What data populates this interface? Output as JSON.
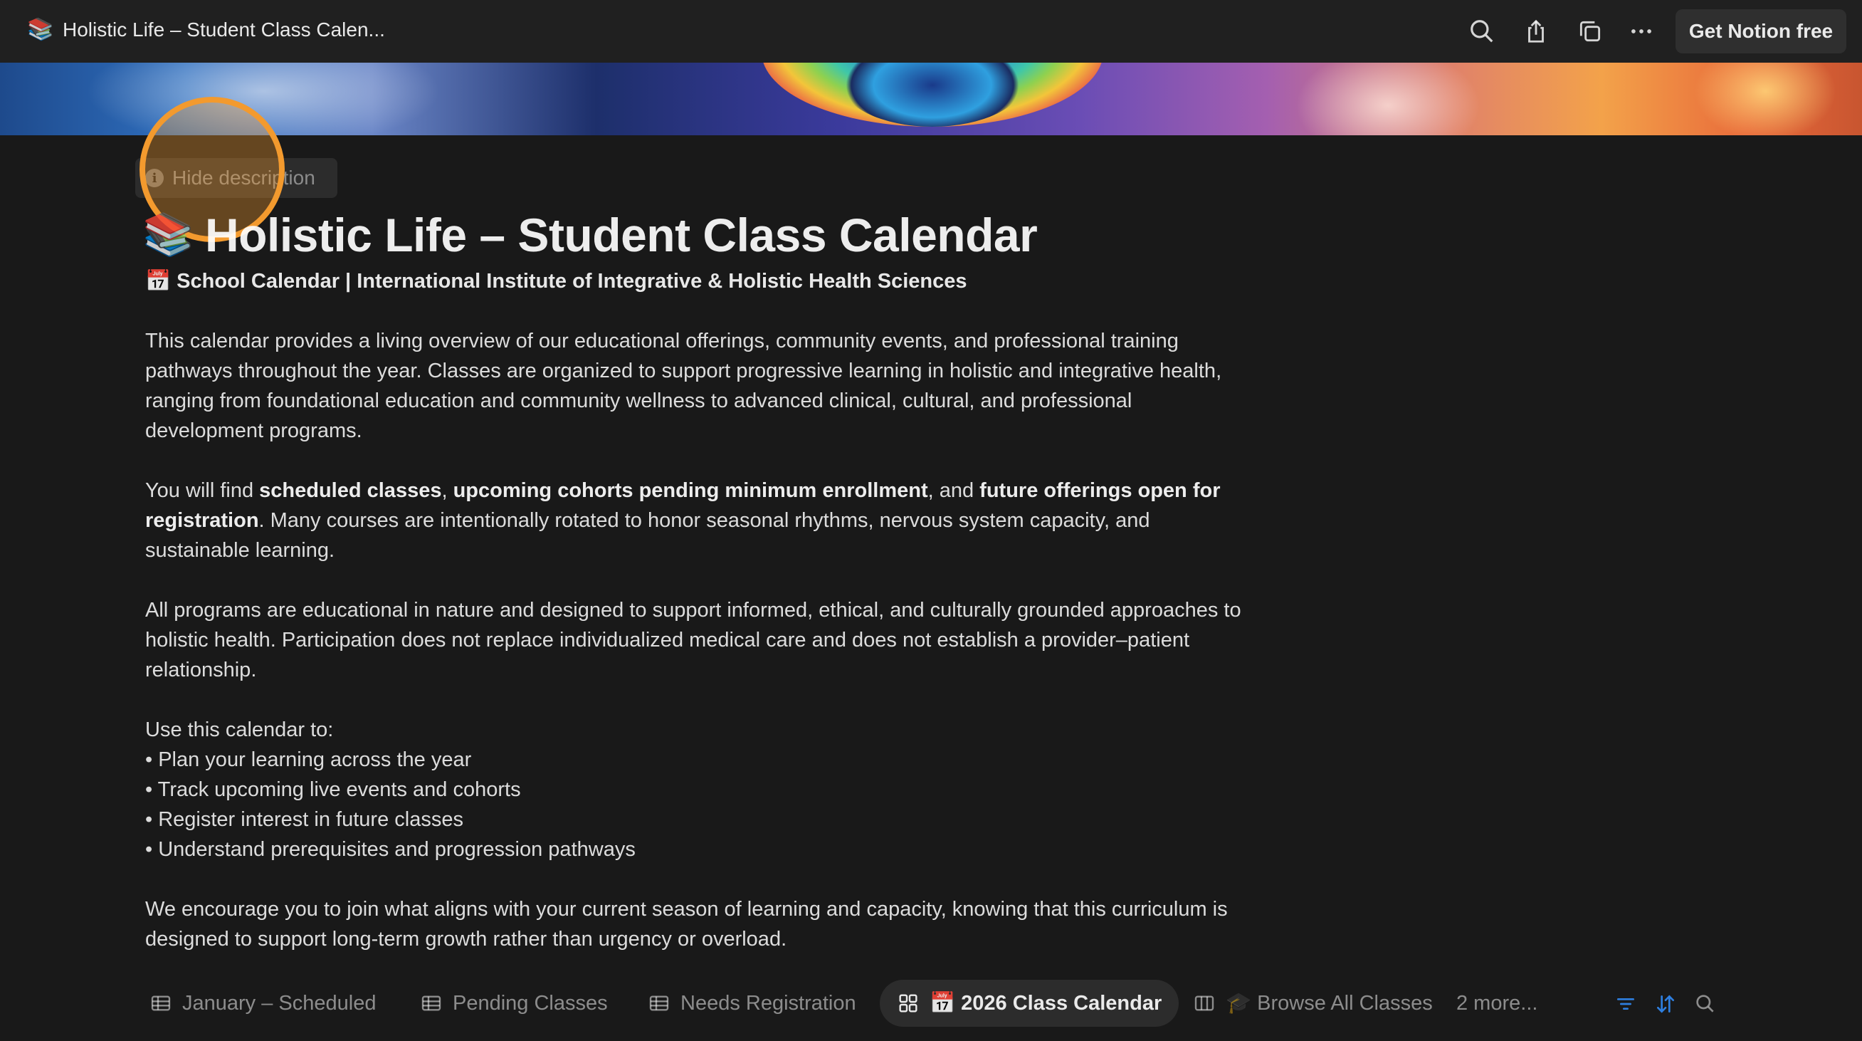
{
  "tab": {
    "emoji": "📚",
    "title": "Holistic Life – Student Class Calen..."
  },
  "topbar": {
    "icons": [
      "search-icon",
      "share-icon",
      "duplicate-icon",
      "more-icon"
    ],
    "cta_label": "Get Notion free"
  },
  "page": {
    "hide_description_label": "Hide description",
    "emoji": "📚",
    "title": "Holistic Life – Student Class Calendar",
    "subtitle": "📅 School Calendar | International Institute of Integrative & Holistic Health Sciences",
    "paragraph1": "This calendar provides a living overview of our educational offerings, community events, and professional training pathways throughout the year. Classes are organized to support progressive learning in holistic and integrative health, ranging from foundational education and community wellness to advanced clinical, cultural, and professional development programs.",
    "paragraph2": {
      "t1": "You will find ",
      "b1": "scheduled classes",
      "t2": ", ",
      "b2": "upcoming cohorts pending minimum enrollment",
      "t3": ", and ",
      "b3": "future offerings open for registration",
      "t4": ". Many courses are intentionally rotated to honor seasonal rhythms, nervous system capacity, and sustainable learning."
    },
    "paragraph3": "All programs are educational in nature and designed to support informed, ethical, and culturally grounded approaches to holistic health. Participation does not replace individualized medical care and does not establish a provider–patient relationship.",
    "use_heading": "Use this calendar to:",
    "bullets": [
      "• Plan your learning across the year",
      "• Track upcoming live events and cohorts",
      "• Register interest in future classes",
      "• Understand prerequisites and progression pathways"
    ],
    "paragraph4": "We encourage you to join what aligns with your current season of learning and capacity, knowing that this curriculum is designed to support long-term growth rather than urgency or overload."
  },
  "views": {
    "tabs": [
      {
        "label": "January – Scheduled",
        "icon": "table-icon"
      },
      {
        "label": "Pending Classes",
        "icon": "table-icon"
      },
      {
        "label": "Needs Registration",
        "icon": "table-icon"
      },
      {
        "label": "📅 2026 Class Calendar",
        "icon": "gallery-icon",
        "active": true
      },
      {
        "label": "🎓 Browse All Classes",
        "icon": "board-icon"
      }
    ],
    "more_label": "2 more...",
    "tools": [
      "filter-icon",
      "sort-icon",
      "search-icon"
    ],
    "accent": "#2e7fe0"
  }
}
